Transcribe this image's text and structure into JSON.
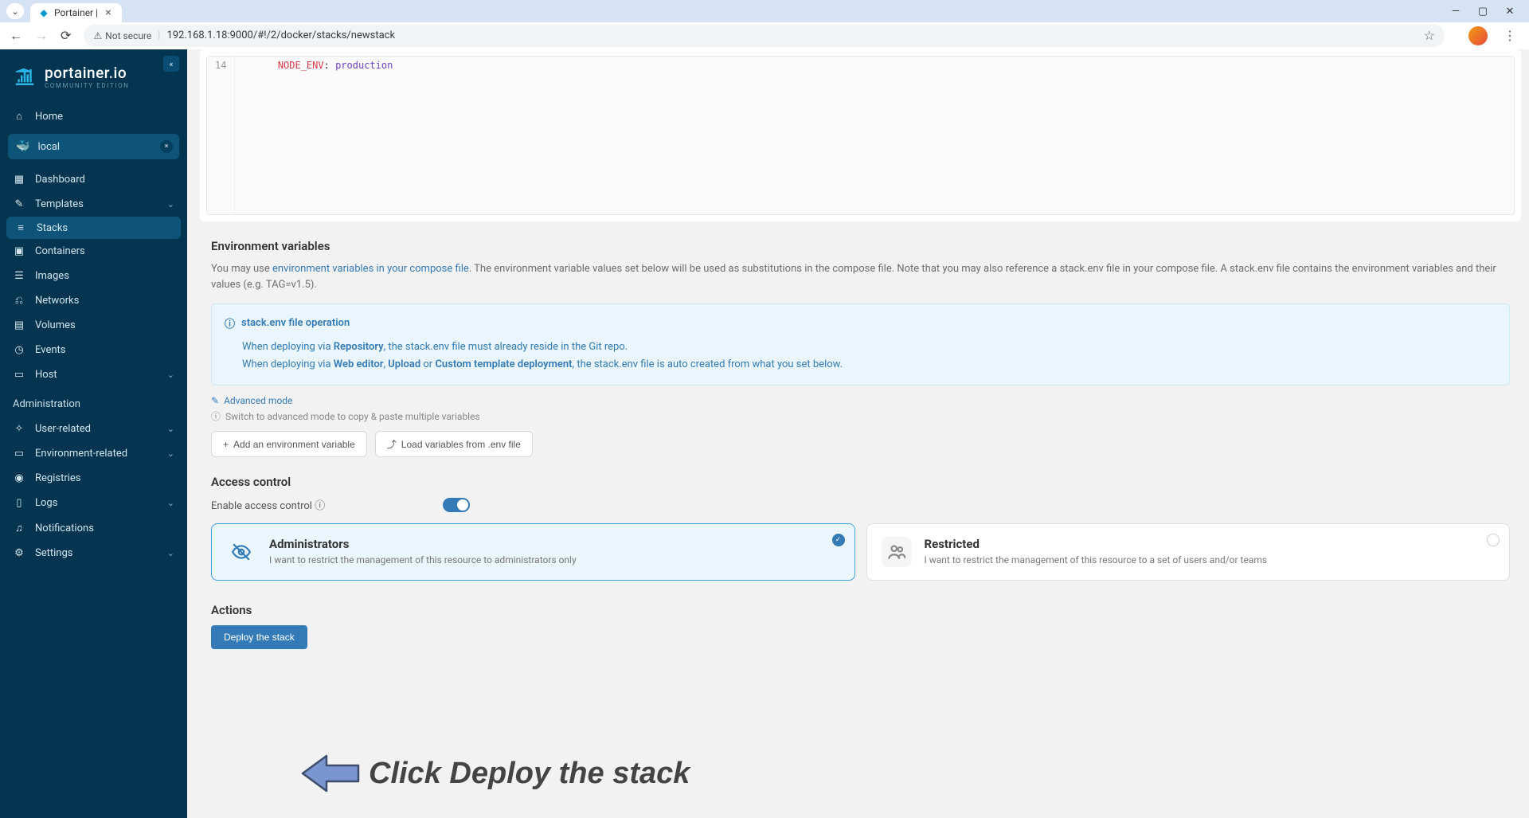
{
  "browser": {
    "tab_title": "Portainer |",
    "not_secure": "Not secure",
    "url": "192.168.1.18:9000/#!/2/docker/stacks/newstack"
  },
  "app": {
    "logo": "portainer.io",
    "edition": "COMMUNITY EDITION",
    "env_name": "local"
  },
  "sidebar": {
    "home": "Home",
    "items": [
      {
        "label": "Dashboard"
      },
      {
        "label": "Templates"
      },
      {
        "label": "Stacks"
      },
      {
        "label": "Containers"
      },
      {
        "label": "Images"
      },
      {
        "label": "Networks"
      },
      {
        "label": "Volumes"
      },
      {
        "label": "Events"
      },
      {
        "label": "Host"
      }
    ],
    "admin_heading": "Administration",
    "admin_items": [
      {
        "label": "User-related"
      },
      {
        "label": "Environment-related"
      },
      {
        "label": "Registries"
      },
      {
        "label": "Logs"
      },
      {
        "label": "Notifications"
      },
      {
        "label": "Settings"
      }
    ]
  },
  "editor": {
    "line_no": "14",
    "code_key": "NODE_ENV",
    "code_val": "production"
  },
  "env_section": {
    "heading": "Environment variables",
    "desc_pre": "You may use ",
    "desc_link": "environment variables in your compose file",
    "desc_post": ". The environment variable values set below will be used as substitutions in the compose file. Note that you may also reference a stack.env file in your compose file. A stack.env file contains the environment variables and their values (e.g. TAG=v1.5).",
    "info_title": "stack.env file operation",
    "info_l1_a": "When deploying via ",
    "info_l1_b": "Repository",
    "info_l1_c": ", the stack.env file must already reside in the Git repo.",
    "info_l2_a": "When deploying via ",
    "info_l2_b": "Web editor",
    "info_l2_c": ", ",
    "info_l2_d": "Upload",
    "info_l2_e": " or ",
    "info_l2_f": "Custom template deployment",
    "info_l2_g": ", the stack.env file is auto created from what you set below.",
    "adv_label": "Advanced mode",
    "adv_hint": "Switch to advanced mode to copy & paste multiple variables",
    "add_btn": "Add an environment variable",
    "load_btn": "Load variables from .env file"
  },
  "access": {
    "heading": "Access control",
    "enable_label": "Enable access control",
    "admins": {
      "title": "Administrators",
      "desc": "I want to restrict the management of this resource to administrators only"
    },
    "restricted": {
      "title": "Restricted",
      "desc": "I want to restrict the management of this resource to a set of users and/or teams"
    }
  },
  "actions": {
    "heading": "Actions",
    "deploy_btn": "Deploy the stack"
  },
  "annotation": "Click Deploy the stack"
}
